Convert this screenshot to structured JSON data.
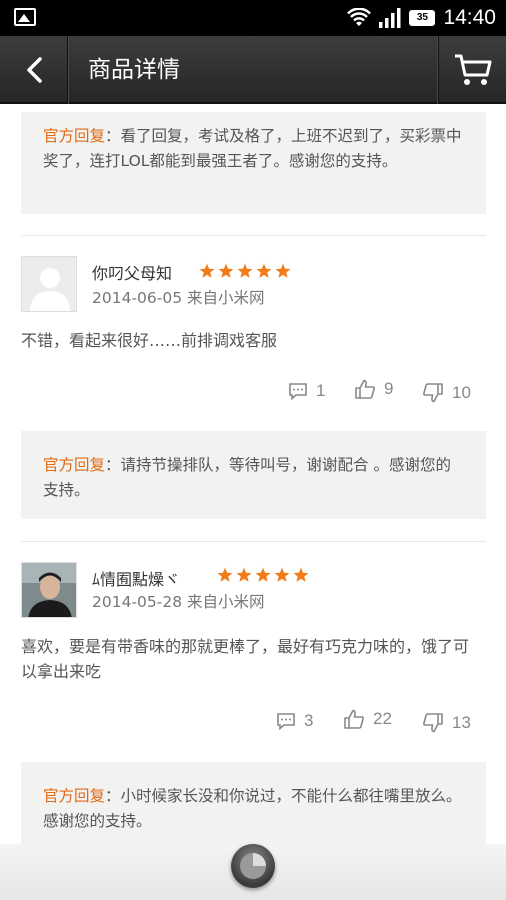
{
  "status_bar": {
    "time": "14:40",
    "battery": "35"
  },
  "header": {
    "title": "商品详情"
  },
  "reviews": [
    {
      "official_reply": {
        "label": "官方回复",
        "text": "：看了回复，考试及格了，上班不迟到了，买彩票中奖了，连打LOL都能到最强王者了。感谢您的支持。"
      }
    },
    {
      "username": "你叼父母知",
      "rating": 5,
      "date_source": "2014-06-05 来自小米网",
      "content": "不错，看起来很好……前排调戏客服",
      "comments": "1",
      "likes": "9",
      "dislikes": "10",
      "official_reply": {
        "label": "官方回复",
        "text": "：请持节操排队，等待叫号，谢谢配合 。感谢您的支持。"
      }
    },
    {
      "username": "ﾑ情囿點燥ヾ",
      "rating": 5,
      "date_source": "2014-05-28 来自小米网",
      "content": "喜欢，要是有带香味的那就更棒了，最好有巧克力味的，饿了可以拿出来吃",
      "comments": "3",
      "likes": "22",
      "dislikes": "13",
      "official_reply": {
        "label": "官方回复",
        "text": "：小时候家长没和你说过，不能什么都往嘴里放么。感谢您的支持。"
      }
    }
  ],
  "colors": {
    "accent": "#e26a14",
    "star": "#f07c1a",
    "titlebar": "#333333"
  },
  "icons": [
    "gallery-icon",
    "wifi-icon",
    "signal-icon",
    "battery-icon",
    "back-arrow-icon",
    "cart-icon",
    "star-icon",
    "comment-icon",
    "thumbs-up-icon",
    "thumbs-down-icon",
    "home-icon"
  ]
}
